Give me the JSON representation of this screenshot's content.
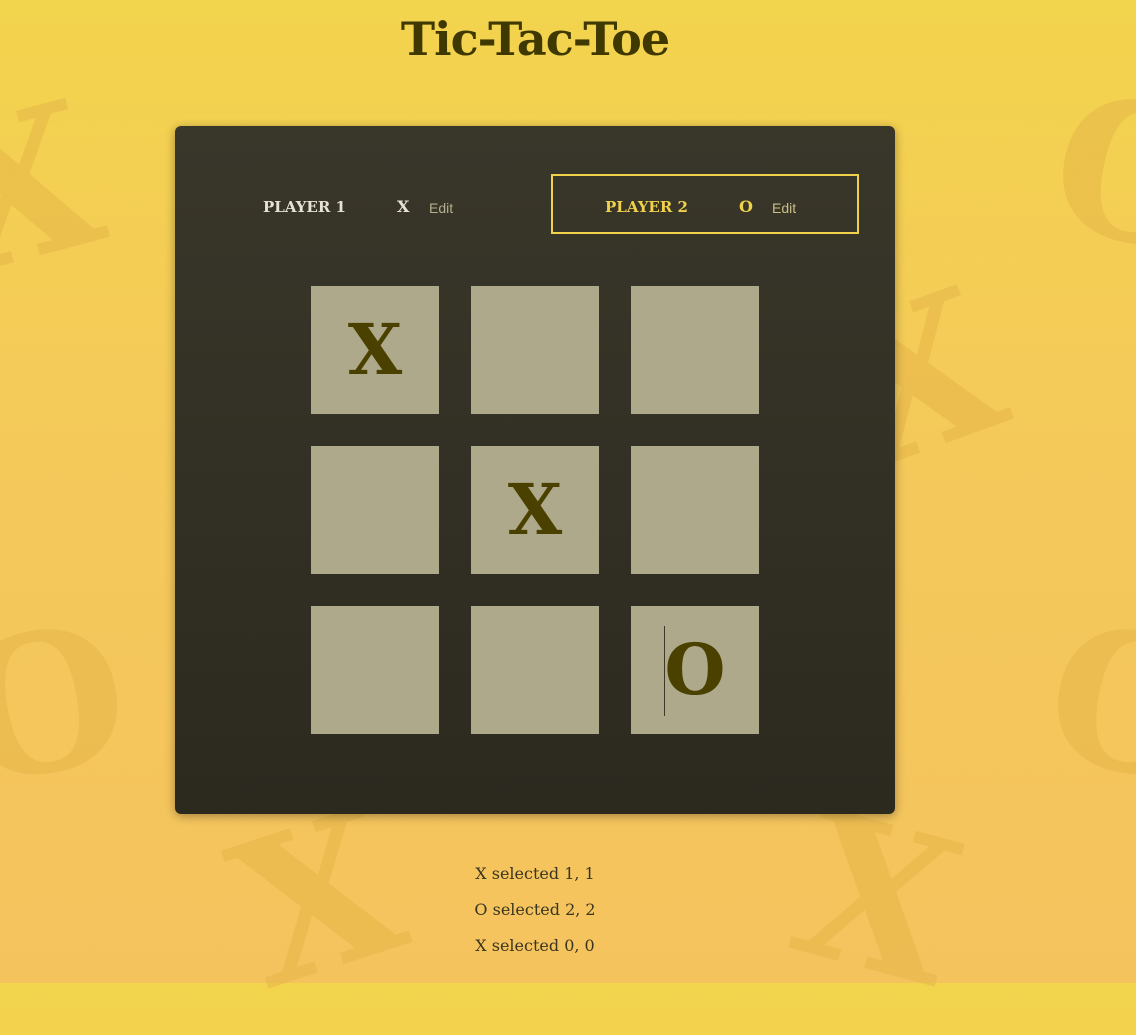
{
  "page": {
    "title": "Tic-Tac-Toe"
  },
  "players": [
    {
      "name": "PLAYER 1",
      "symbol": "X",
      "edit_label": "Edit",
      "active": false
    },
    {
      "name": "PLAYER 2",
      "symbol": "O",
      "edit_label": "Edit",
      "active": true
    }
  ],
  "board": {
    "cells": [
      [
        "X",
        "",
        ""
      ],
      [
        "",
        "X",
        ""
      ],
      [
        "",
        "",
        "O"
      ]
    ]
  },
  "log": [
    "X selected 1, 1",
    "O selected 2, 2",
    "X selected 0, 0"
  ],
  "colors": {
    "accent": "#f0d24a",
    "mark": "#4a4100",
    "cell": "#aea98a",
    "panel": "#33311f"
  }
}
